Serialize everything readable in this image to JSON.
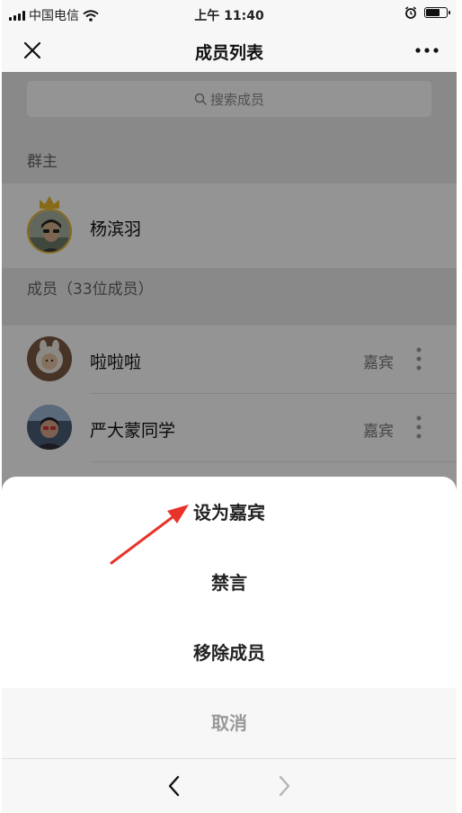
{
  "status_bar": {
    "carrier": "中国电信",
    "time": "上午 11:40",
    "signal_icon": "signal-icon",
    "wifi_icon": "wifi-icon",
    "alarm_icon": "alarm-icon",
    "battery_level_fraction": 0.7
  },
  "nav": {
    "title": "成员列表",
    "close_icon": "close-icon",
    "more_icon": "more-horizontal-icon"
  },
  "search": {
    "placeholder": "搜索成员",
    "icon": "search-icon"
  },
  "owner_section": {
    "header": "群主",
    "members": [
      {
        "name": "杨滨羽",
        "badge_icon": "crown-icon"
      }
    ]
  },
  "member_section": {
    "header": "成员（33位成员）",
    "members": [
      {
        "name": "啦啦啦",
        "role": "嘉宾"
      },
      {
        "name": "严大蒙同学",
        "role": "嘉宾"
      }
    ]
  },
  "action_sheet": {
    "options": [
      "设为嘉宾",
      "禁言",
      "移除成员"
    ],
    "cancel": "取消"
  },
  "browser_nav": {
    "back_icon": "chevron-left-icon",
    "forward_icon": "chevron-right-icon"
  },
  "colors": {
    "annotation_arrow": "#e8332b",
    "crown": "#e8b92b",
    "background": "#ededed"
  }
}
